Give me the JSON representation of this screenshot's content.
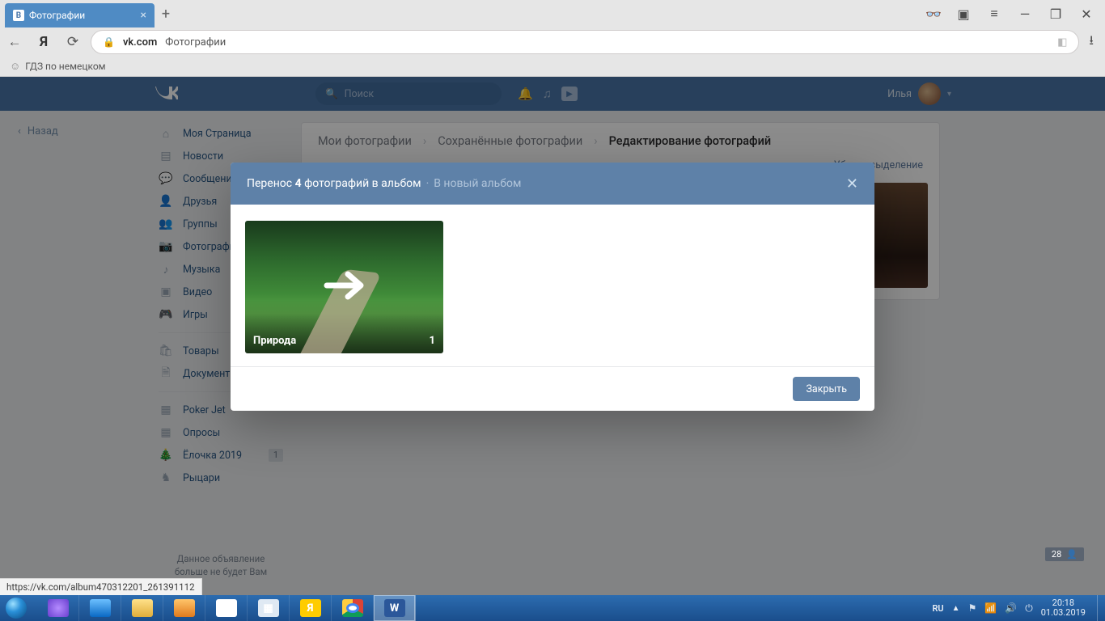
{
  "browser": {
    "tab_title": "Фотографии",
    "bookmark_text": "ГДЗ по немецком",
    "addr_host": "vk.com",
    "addr_title": "Фотографии",
    "status_url": "https://vk.com/album470312201_261391112"
  },
  "vk": {
    "search_placeholder": "Поиск",
    "user_name": "Илья",
    "back_label": "Назад",
    "nav": {
      "my_page": "Моя Страница",
      "news": "Новости",
      "messages": "Сообщения",
      "friends": "Друзья",
      "groups": "Группы",
      "photos": "Фотографии",
      "music": "Музыка",
      "video": "Видео",
      "games": "Игры",
      "market": "Товары",
      "documents": "Документы",
      "poker": "Poker Jet",
      "polls": "Опросы",
      "yolka": "Ёлочка 2019",
      "yolka_badge": "1",
      "knights": "Рыцари"
    },
    "ad_line1": "Данное объявление",
    "ad_line2": "больше не будет Вам",
    "crumbs": {
      "c1": "Мои фотографии",
      "c2": "Сохранённые фотографии",
      "c3": "Редактирование фотографий"
    },
    "clear_selection": "Убрать выделение"
  },
  "modal": {
    "title_pre": "Перенос ",
    "title_count": "4",
    "title_post": " фотографий в альбом",
    "new_album": "В новый альбом",
    "album_name": "Природа",
    "album_count": "1",
    "close_btn": "Закрыть"
  },
  "chip": {
    "count": "28"
  },
  "tray": {
    "lang": "RU",
    "time": "20:18",
    "date": "01.03.2019"
  }
}
